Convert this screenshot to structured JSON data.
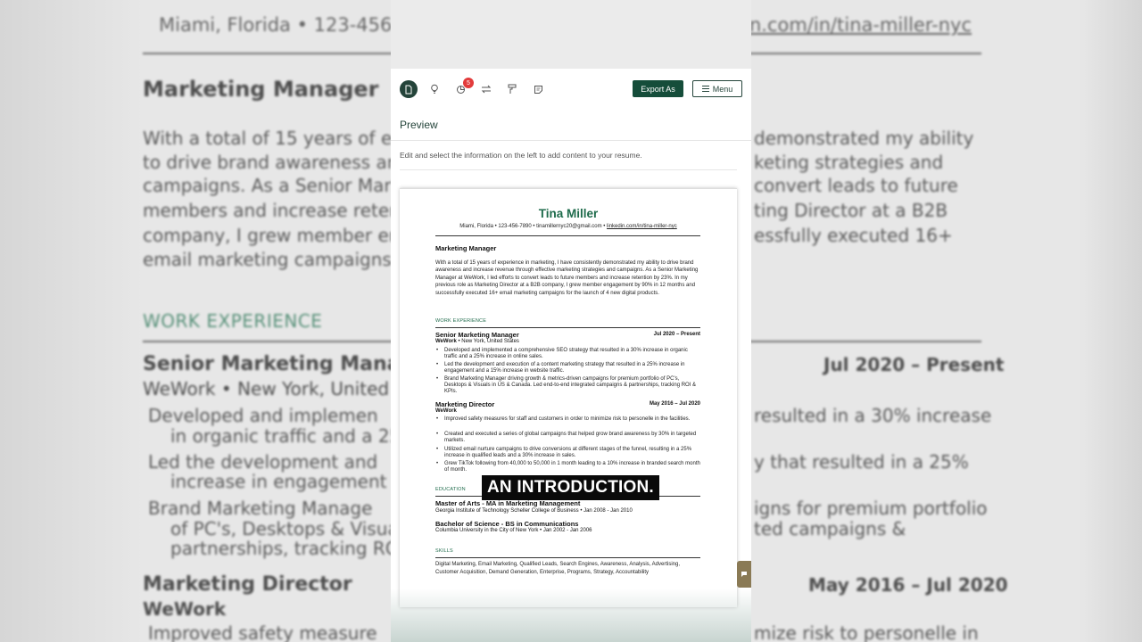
{
  "background": {
    "contact_left": "Miami, Florida • 123-456-78",
    "contact_right": "n.com/in/tina-miller-nyc",
    "heading": "Marketing Manager",
    "para_left": [
      "With a total of 15 years of exp",
      "to drive brand awareness an",
      "campaigns. As a Senior Mark",
      "members and increase reten",
      "company, I grew member en",
      "email marketing campaigns"
    ],
    "para_right": [
      "demonstrated my ability",
      "keting strategies and",
      "convert leads to future",
      "ting Director at a B2B",
      "essfully executed 16+"
    ],
    "section": "WORK EXPERIENCE",
    "job1": "Senior Marketing Mana",
    "job1_date": "Jul 2020 – Present",
    "job1_co": "WeWork • New York, United S",
    "bullets_left": [
      "Developed and implemen",
      "in organic traffic and a 25",
      "Led the development and",
      "increase in engagement",
      "Brand Marketing Manage",
      "of PC's, Desktops & Visual",
      "partnerships, tracking RO"
    ],
    "bullets_right": [
      "resulted in a 30% increase",
      "y that resulted in a 25%",
      "igns for premium portfolio",
      "ted campaigns &"
    ],
    "job2": "Marketing Director",
    "job2_date": "May 2016 – Jul 2020",
    "job2_co": "WeWork",
    "bullet_bottom_left": "Improved safety measure",
    "bullet_bottom_right": "mize risk to personelle in"
  },
  "toolbar": {
    "notification_count": "5",
    "export_label": "Export As",
    "menu_label": "Menu"
  },
  "preview": {
    "title": "Preview",
    "helper_text": "Edit and select the information on the left to add content to your resume."
  },
  "resume": {
    "name": "Tina Miller",
    "contact": "Miami, Florida • 123-456-7890 • tinamillernyc20@gmail.com • ",
    "contact_link": "linkedin.com/in/tina-miller-nyc",
    "title": "Marketing Manager",
    "summary": "With a total of 15 years of experience in marketing, I have consistently demonstrated my ability to drive brand awareness and increase revenue through effective marketing strategies and campaigns. As a Senior Marketing Manager at WeWork, I led efforts to convert leads to future members and increase retention by 23%. In my previous role as Marketing Director at a B2B company, I grew member engagement by 90% in 12 months and successfully executed 16+ email marketing campaigns for the launch of 4 new digital products.",
    "work_heading": "WORK EXPERIENCE",
    "jobs": [
      {
        "title": "Senior Marketing Manager",
        "dates": "Jul 2020 – Present",
        "company": "WeWork",
        "location": " • New York, United States",
        "bullets": [
          "Developed and implemented a comprehensive SEO strategy that resulted in a 30% increase in organic traffic and a 25% increase in online sales.",
          "Led the development and execution of a content marketing strategy that resulted in a 25% increase in engagement and a 15% increase in website traffic.",
          "Brand Marketing Manager driving growth & metrics-driven campaigns for premium portfolio of PC's, Desktops & Visuals in US & Canada. Led end-to-end integrated campaigns & partnerships, tracking ROI & KPIs."
        ]
      },
      {
        "title": "Marketing Director",
        "dates": "May 2016 – Jul 2020",
        "company": "WeWork",
        "location": "",
        "bullets": [
          "Improved safety measures for staff and customers in order to minimize risk to personelle in the facilities.",
          "Created and executed a series of global campaigns that helped grow brand awareness by 30% in targeted markets.",
          "Utilized email nurture campaigns to drive conversions at different stages of the funnel, resulting in a 25% increase in qualified leads and a 30% increase in sales.",
          "Grew TikTok following from 40,000 to 50,000 in 1 month leading to a 10% increase in branded search month of month."
        ]
      }
    ],
    "education_heading": "EDUCATION",
    "education": [
      {
        "degree": "Master of Arts - MA in Marketing Management",
        "detail": "Georgia Institute of Technology Scheller College of Business • Jan 2008 - Jan 2010"
      },
      {
        "degree": "Bachelor of Science - BS in Communications",
        "detail": "Columbia University in the City of New York • Jan 2002 - Jan 2006"
      }
    ],
    "skills_heading": "SKILLS",
    "skills": "Digital Marketing, Email Marketing, Qualified Leads, Search Engines, Awareness, Analysis, Advertising, Customer Acquisition, Demand Generation, Enterprise, Programs, Strategy, Accountability"
  },
  "caption": "AN INTRODUCTION."
}
